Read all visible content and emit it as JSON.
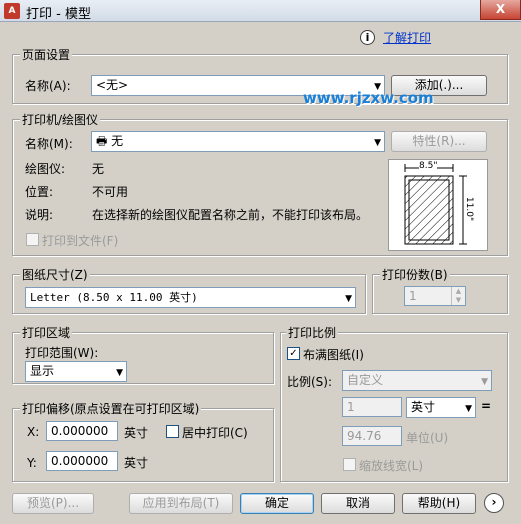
{
  "window": {
    "title": "打印 - 模型",
    "app_icon": "A",
    "close": "X"
  },
  "help_link": "了解打印",
  "watermark": "www.rjzxw.com",
  "page_setup": {
    "group": "页面设置",
    "name_label": "名称(A):",
    "name_value": "<无>",
    "add_button": "添加(.)..."
  },
  "printer": {
    "group": "打印机/绘图仪",
    "name_label": "名称(M):",
    "name_value": "无",
    "properties_button": "特性(R)...",
    "plotter_label": "绘图仪:",
    "plotter_value": "无",
    "location_label": "位置:",
    "location_value": "不可用",
    "description_label": "说明:",
    "description_value": "在选择新的绘图仪配置名称之前，不能打印该布局。",
    "print_to_file": "打印到文件(F)",
    "preview_width": "8.5\"",
    "preview_height": "11.0\""
  },
  "paper_size": {
    "group": "图纸尺寸(Z)",
    "value": "Letter (8.50 x 11.00 英寸)"
  },
  "copies": {
    "group": "打印份数(B)",
    "value": "1"
  },
  "plot_area": {
    "group": "打印区域",
    "range_label": "打印范围(W):",
    "range_value": "显示"
  },
  "plot_offset": {
    "group": "打印偏移(原点设置在可打印区域)",
    "x_label": "X:",
    "x_value": "0.000000",
    "x_unit": "英寸",
    "center_label": "居中打印(C)",
    "y_label": "Y:",
    "y_value": "0.000000",
    "y_unit": "英寸"
  },
  "plot_scale": {
    "group": "打印比例",
    "fit_label": "布满图纸(I)",
    "scale_label": "比例(S):",
    "scale_value": "自定义",
    "num_value": "1",
    "unit_value": "英寸",
    "equals": "=",
    "den_value": "94.76",
    "den_unit": "单位(U)",
    "lineweights_label": "缩放线宽(L)"
  },
  "buttons": {
    "preview": "预览(P)...",
    "apply_layout": "应用到布局(T)",
    "ok": "确定",
    "cancel": "取消",
    "help": "帮助(H)",
    "expand": "›"
  }
}
